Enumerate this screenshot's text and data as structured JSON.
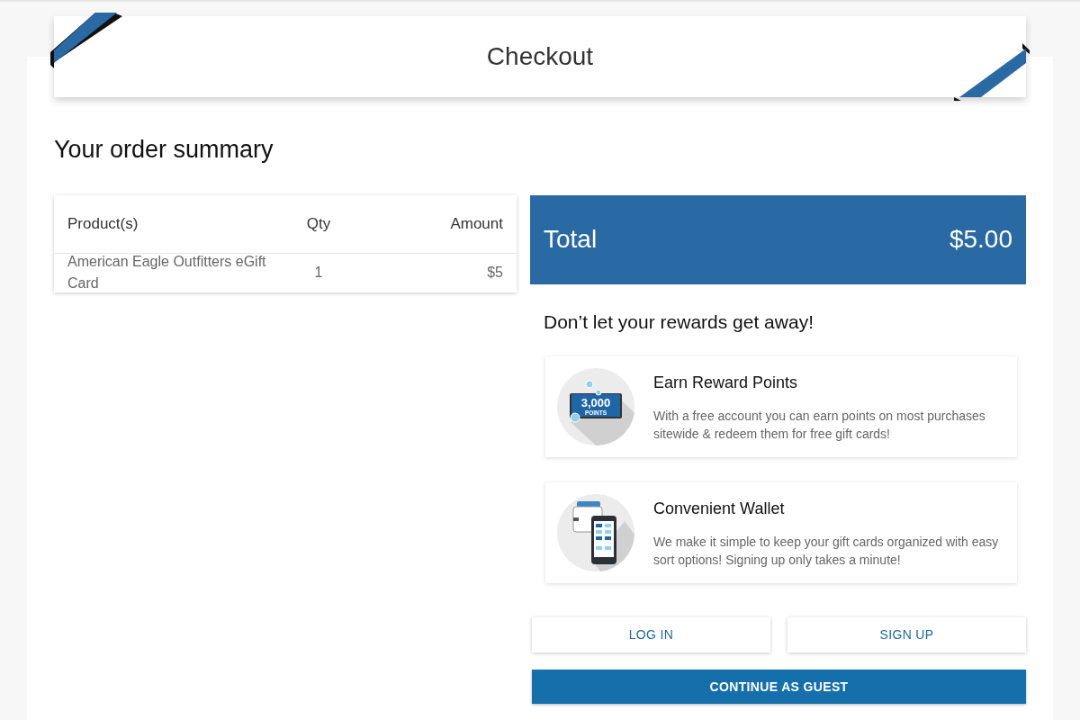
{
  "header": {
    "title": "Checkout"
  },
  "order_summary": {
    "heading": "Your order summary",
    "columns": [
      "Product(s)",
      "Qty",
      "Amount"
    ],
    "rows": [
      [
        "American Eagle Outfitters eGift Card",
        "1",
        "$5"
      ]
    ]
  },
  "total": {
    "label": "Total",
    "value": "$5.00"
  },
  "rewards": {
    "heading": "Don’t let your rewards get away!",
    "cards": [
      {
        "kind": "points",
        "icon_text": [
          "3,000",
          "POINTS"
        ],
        "title": "Earn Reward Points",
        "text": "With a free account you can earn points on most purchases sitewide & redeem them for free gift cards!"
      },
      {
        "kind": "wallet",
        "title": "Convenient Wallet",
        "text": "We make it simple to keep your gift cards organized with easy sort options! Signing up only takes a minute!"
      }
    ]
  },
  "buttons": [
    {
      "kind": "outline",
      "label": "LOG IN"
    },
    {
      "kind": "outline",
      "label": "SIGN UP"
    },
    {
      "kind": "primary",
      "label": "CONTINUE AS GUEST"
    }
  ]
}
